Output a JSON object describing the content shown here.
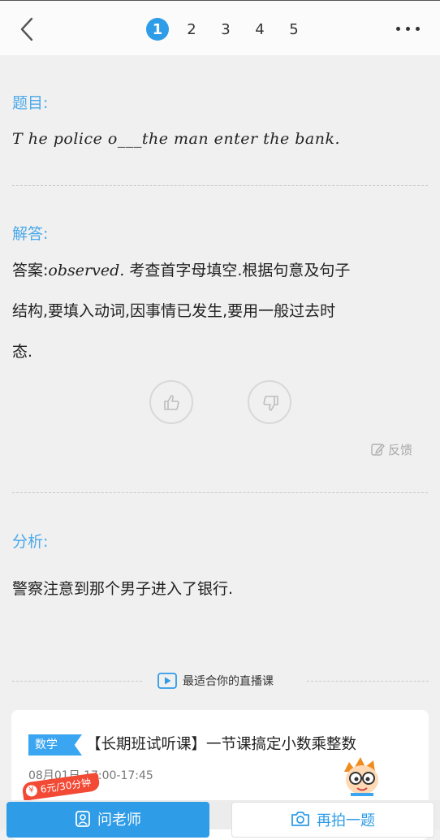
{
  "header": {
    "pages": [
      "1",
      "2",
      "3",
      "4",
      "5"
    ],
    "active_page": "1"
  },
  "question": {
    "title": "题目:",
    "text": "T he police o___the man enter the bank."
  },
  "answer": {
    "title": "解答:",
    "line1_prefix": "答案:",
    "line1_word": "observed.",
    "line1_rest": "考查首字母填空.根据句意及句子",
    "line2": "结构,要填入动词,因事情已发生,要用一般过去时",
    "line3": "态."
  },
  "feedback": {
    "label": "反馈"
  },
  "analysis": {
    "title": "分析:",
    "text": "警察注意到那个男子进入了银行."
  },
  "live": {
    "header": "最适合你的直播课",
    "course": {
      "subject": "数学",
      "title": "【长期班试听课】一节课搞定小数乘整数",
      "time": "08月01日 17:00-17:45",
      "price": "6元/30分钟"
    }
  },
  "bottom": {
    "ask_label": "问老师",
    "photo_label": "再拍一题"
  },
  "colors": {
    "accent": "#2f9ce8",
    "section_title": "#4aa9ea",
    "price_badge": "#f24a35"
  }
}
